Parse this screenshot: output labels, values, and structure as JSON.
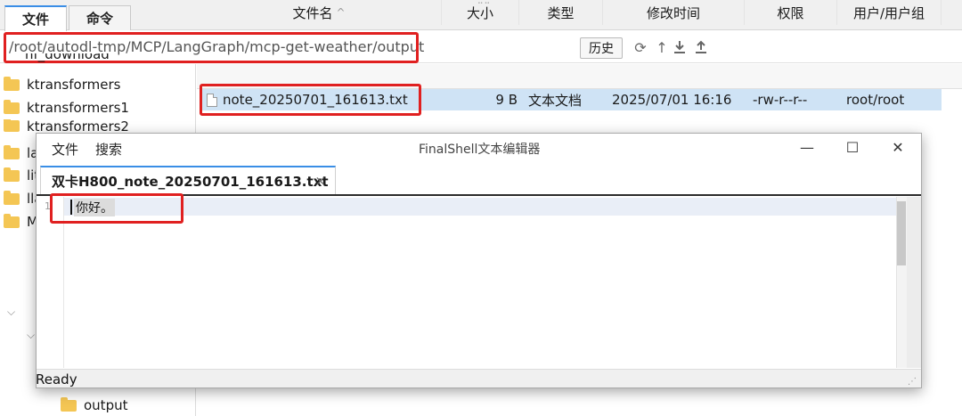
{
  "app_tabs": [
    {
      "label": "文件",
      "active": true
    },
    {
      "label": "命令",
      "active": false
    }
  ],
  "path": {
    "value": "/root/autodl-tmp/MCP/LangGraph/mcp-get-weather/output",
    "history_label": "历史",
    "icons": [
      "refresh-icon",
      "up-arrow-icon",
      "download-icon",
      "upload-icon"
    ]
  },
  "tree": {
    "items": [
      {
        "label": "hf_download"
      },
      {
        "label": "ktransformers"
      },
      {
        "label": "ktransformers1"
      },
      {
        "label": "ktransformers2"
      },
      {
        "label": "la"
      },
      {
        "label": "lit"
      },
      {
        "label": "lla"
      },
      {
        "label": "M"
      },
      {
        "label": "output"
      }
    ]
  },
  "table": {
    "columns": [
      "文件名",
      "大小",
      "类型",
      "修改时间",
      "权限",
      "用户/用户组"
    ],
    "sort_indicator": "^",
    "rows": [
      {
        "name": "note_20250701_161613.txt",
        "size": "9 B",
        "type": "文本文档",
        "modified": "2025/07/01 16:16",
        "permissions": "-rw-r--r--",
        "owner": "root/root"
      }
    ]
  },
  "editor": {
    "menu": [
      "文件",
      "搜索"
    ],
    "title": "FinalShell文本编辑器",
    "tab_label": "双卡H800_note_20250701_161613.txt",
    "line_number": "1",
    "content": "你好。",
    "status": "Ready",
    "window_buttons": {
      "minimize": "—",
      "maximize": "☐",
      "close": "✕"
    }
  },
  "colors": {
    "accent": "#3a8ee6",
    "highlight_box": "#e02020",
    "selected_row": "#cfe3f5",
    "folder": "#f4c654"
  }
}
